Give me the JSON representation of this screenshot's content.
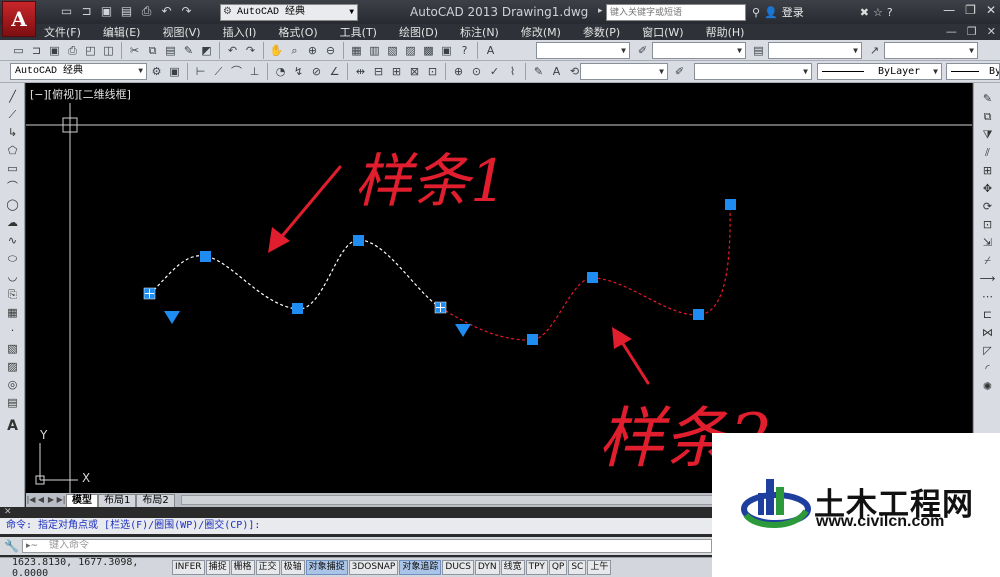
{
  "app": {
    "logo_letter": "A",
    "title": "AutoCAD 2013   Drawing1.dwg"
  },
  "workspace": {
    "selected": "AutoCAD 经典"
  },
  "search": {
    "placeholder": "键入关键字或短语"
  },
  "account": {
    "login_label": "登录"
  },
  "menu": {
    "items": [
      "文件(F)",
      "编辑(E)",
      "视图(V)",
      "插入(I)",
      "格式(O)",
      "工具(T)",
      "绘图(D)",
      "标注(N)",
      "修改(M)",
      "参数(P)",
      "窗口(W)",
      "帮助(H)"
    ]
  },
  "toolbar2": {
    "style_select": "AutoCAD 经典",
    "linetype": "ByLayer",
    "lineweight": "ByLayer"
  },
  "viewport": {
    "label": "[−][俯视][二维线框]"
  },
  "axes": {
    "y_label": "Y",
    "x_label": "X"
  },
  "annotations": {
    "spline1_label": "样条1",
    "spline2_label": "样条2",
    "colors": {
      "spline1": "#ffffff",
      "spline2": "#e8182a",
      "grips": "#1e8cf0",
      "annotation_red": "#e01e2e"
    }
  },
  "layout_tabs": {
    "model": "模型",
    "layout1": "布局1",
    "layout2": "布局2"
  },
  "command": {
    "history": "命令: 指定对角点或 [栏选(F)/圈围(WP)/圈交(CP)]:",
    "input_placeholder": "键入命令"
  },
  "status": {
    "coords": "1623.8130, 1677.3098, 0.0000",
    "buttons": [
      {
        "label": "INFER",
        "on": false
      },
      {
        "label": "捕捉",
        "on": false
      },
      {
        "label": "栅格",
        "on": false
      },
      {
        "label": "正交",
        "on": false
      },
      {
        "label": "极轴",
        "on": false
      },
      {
        "label": "对象捕捉",
        "on": true
      },
      {
        "label": "3DOSNAP",
        "on": false
      },
      {
        "label": "对象追踪",
        "on": true
      },
      {
        "label": "DUCS",
        "on": false
      },
      {
        "label": "DYN",
        "on": false
      },
      {
        "label": "线宽",
        "on": false
      },
      {
        "label": "TPY",
        "on": false
      },
      {
        "label": "QP",
        "on": false
      },
      {
        "label": "SC",
        "on": false
      },
      {
        "label": "上午",
        "on": false
      }
    ]
  },
  "watermark": {
    "name": "土木工程网",
    "url": "www.civilcn.com"
  }
}
